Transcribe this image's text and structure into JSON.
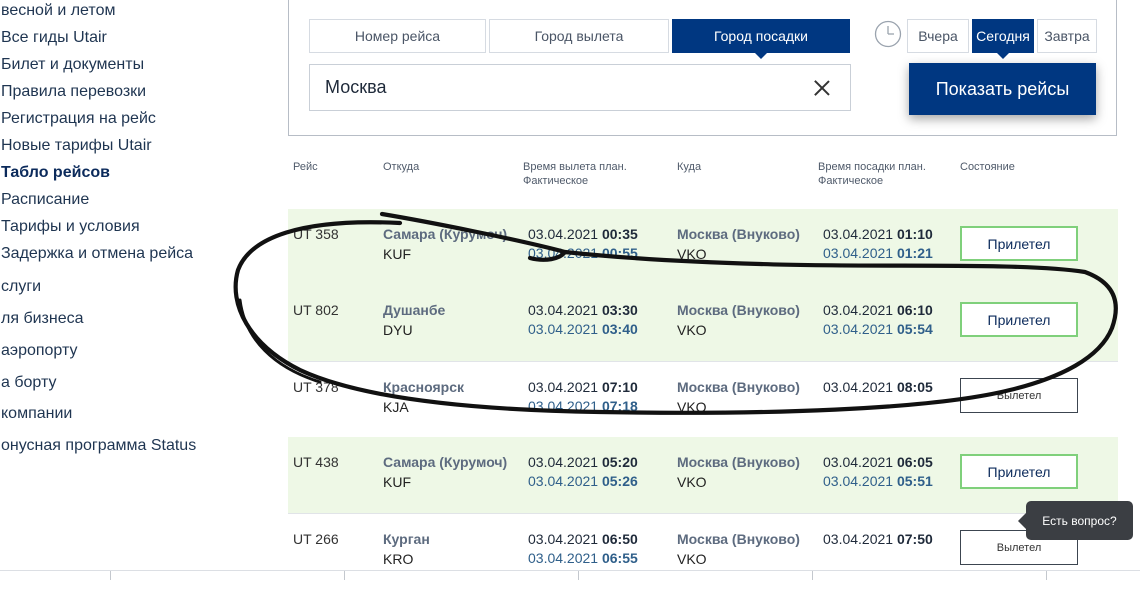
{
  "sidebar": {
    "items": [
      "весной и летом",
      "Все гиды Utair",
      "Билет и документы",
      "Правила перевозки",
      "Регистрация на рейс",
      "Новые тарифы Utair",
      "Табло рейсов",
      "Расписание",
      "Тарифы и условия",
      "Задержка и отмена рейса",
      "слуги",
      "ля бизнеса",
      " аэропорту",
      "а борту",
      " компании",
      "онусная программа Status"
    ],
    "active_index": 6
  },
  "search": {
    "tabs": [
      "Номер рейса",
      "Город вылета",
      "Город посадки"
    ],
    "active_tab": 2,
    "input_value": "Москва",
    "days": [
      "Вчера",
      "Сегодня",
      "Завтра"
    ],
    "active_day": 1,
    "show_button": "Показать рейсы"
  },
  "table": {
    "headers": {
      "flight": "Рейс",
      "from": "Откуда",
      "dep": "Время вылета план.",
      "dep_fact": "Фактическое",
      "to": "Куда",
      "arr": "Время посадки план.",
      "arr_fact": "Фактическое",
      "status": "Состояние"
    },
    "rows": [
      {
        "flight": "UT 358",
        "from_city": "Самара (Курумоч)",
        "from_code": "KUF",
        "dep_plan_date": "03.04.2021",
        "dep_plan_time": "00:35",
        "dep_fact_date": "03.04.2021",
        "dep_fact_time": "00:55",
        "to_city": "Москва (Внуково)",
        "to_code": "VKO",
        "arr_plan_date": "03.04.2021",
        "arr_plan_time": "01:10",
        "arr_fact_date": "03.04.2021",
        "arr_fact_time": "01:21",
        "status": "Прилетел",
        "status_kind": "landed"
      },
      {
        "flight": "UT 802",
        "from_city": "Душанбе",
        "from_code": "DYU",
        "dep_plan_date": "03.04.2021",
        "dep_plan_time": "03:30",
        "dep_fact_date": "03.04.2021",
        "dep_fact_time": "03:40",
        "to_city": "Москва (Внуково)",
        "to_code": "VKO",
        "arr_plan_date": "03.04.2021",
        "arr_plan_time": "06:10",
        "arr_fact_date": "03.04.2021",
        "arr_fact_time": "05:54",
        "status": "Прилетел",
        "status_kind": "landed"
      },
      {
        "flight": "UT 378",
        "from_city": "Красноярск",
        "from_code": "KJA",
        "dep_plan_date": "03.04.2021",
        "dep_plan_time": "07:10",
        "dep_fact_date": "03.04.2021",
        "dep_fact_time": "07:18",
        "to_city": "Москва (Внуково)",
        "to_code": "VKO",
        "arr_plan_date": "03.04.2021",
        "arr_plan_time": "08:05",
        "arr_fact_date": "",
        "arr_fact_time": "",
        "status": "Вылетел",
        "status_kind": "departed"
      },
      {
        "flight": "UT 438",
        "from_city": "Самара (Курумоч)",
        "from_code": "KUF",
        "dep_plan_date": "03.04.2021",
        "dep_plan_time": "05:20",
        "dep_fact_date": "03.04.2021",
        "dep_fact_time": "05:26",
        "to_city": "Москва (Внуково)",
        "to_code": "VKO",
        "arr_plan_date": "03.04.2021",
        "arr_plan_time": "06:05",
        "arr_fact_date": "03.04.2021",
        "arr_fact_time": "05:51",
        "status": "Прилетел",
        "status_kind": "landed"
      },
      {
        "flight": "UT 266",
        "from_city": "Курган",
        "from_code": "KRO",
        "dep_plan_date": "03.04.2021",
        "dep_plan_time": "06:50",
        "dep_fact_date": "03.04.2021",
        "dep_fact_time": "06:55",
        "to_city": "Москва (Внуково)",
        "to_code": "VKO",
        "arr_plan_date": "03.04.2021",
        "arr_plan_time": "07:50",
        "arr_fact_date": "",
        "arr_fact_time": "",
        "status": "Вылетел",
        "status_kind": "departed"
      }
    ]
  },
  "tooltip": "Есть вопрос?",
  "colors": {
    "brand_blue": "#003781",
    "fact_blue": "#2f5f8a",
    "landed_border": "#7fd07b",
    "row_green": "#eef8e6"
  },
  "icons": {
    "clear": "close-icon",
    "clock": "clock-icon"
  }
}
